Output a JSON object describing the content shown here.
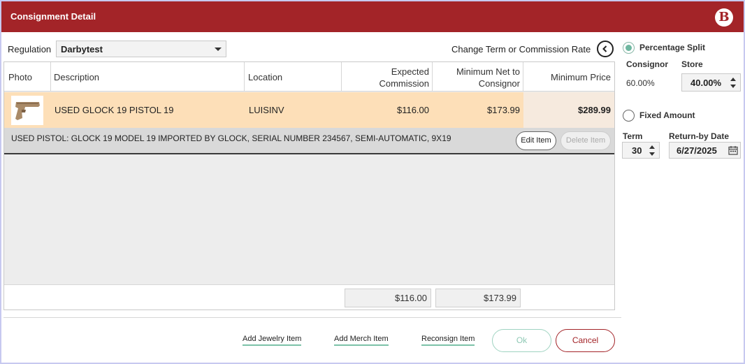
{
  "window": {
    "title": "Consignment Detail",
    "logo_letter": "B"
  },
  "regulation": {
    "label": "Regulation",
    "value": "Darbytest"
  },
  "change_term_label": "Change Term or Commission Rate",
  "table": {
    "headers": {
      "photo": "Photo",
      "description": "Description",
      "location": "Location",
      "expected_commission": "Expected Commission",
      "minimum_net": "Minimum Net to Consignor",
      "minimum_price": "Minimum Price"
    },
    "rows": [
      {
        "description": "USED GLOCK 19 PISTOL 19",
        "location": "LUISINV",
        "expected_commission": "$116.00",
        "minimum_net": "$173.99",
        "minimum_price": "$289.99",
        "detail": "USED PISTOL: GLOCK 19 MODEL 19 IMPORTED BY GLOCK, SERIAL NUMBER 234567, SEMI-AUTOMATIC, 9X19",
        "photo_icon": "pistol-image"
      }
    ],
    "edit_label": "Edit Item",
    "delete_label": "Delete Item",
    "totals": {
      "expected_commission": "$116.00",
      "minimum_net": "$173.99"
    }
  },
  "split": {
    "percentage_label": "Percentage Split",
    "consignor_label": "Consignor",
    "store_label": "Store",
    "consignor_value": "60.00%",
    "store_value": "40.00%",
    "fixed_label": "Fixed Amount",
    "selected": "percentage"
  },
  "term": {
    "label": "Term",
    "value": "30"
  },
  "return_by": {
    "label": "Return-by Date",
    "value": "6/27/2025"
  },
  "actions": {
    "add_jewelry": "Add Jewelry Item",
    "add_merch": "Add Merch Item",
    "reconsign": "Reconsign Item",
    "ok": "Ok",
    "cancel": "Cancel"
  },
  "colors": {
    "brand": "#a32428",
    "accent": "#6fb7a0",
    "row_highlight": "#fddfb8"
  }
}
